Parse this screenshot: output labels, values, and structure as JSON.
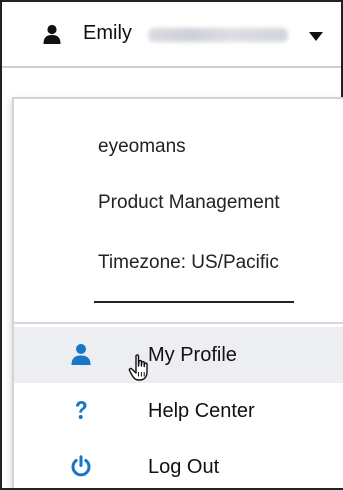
{
  "header": {
    "user_name": "Emily",
    "user_icon": "user-icon",
    "caret_icon": "caret-down-icon"
  },
  "profile": {
    "username": "eyeomans",
    "department": "Product Management",
    "timezone": "Timezone: US/Pacific"
  },
  "menu": {
    "items": [
      {
        "label": "My Profile",
        "icon": "user-icon"
      },
      {
        "label": "Help Center",
        "icon": "question-icon"
      },
      {
        "label": "Log Out",
        "icon": "power-icon"
      }
    ]
  },
  "colors": {
    "accent": "#1976c4",
    "hover_bg": "#eceef1",
    "text": "#111111"
  }
}
